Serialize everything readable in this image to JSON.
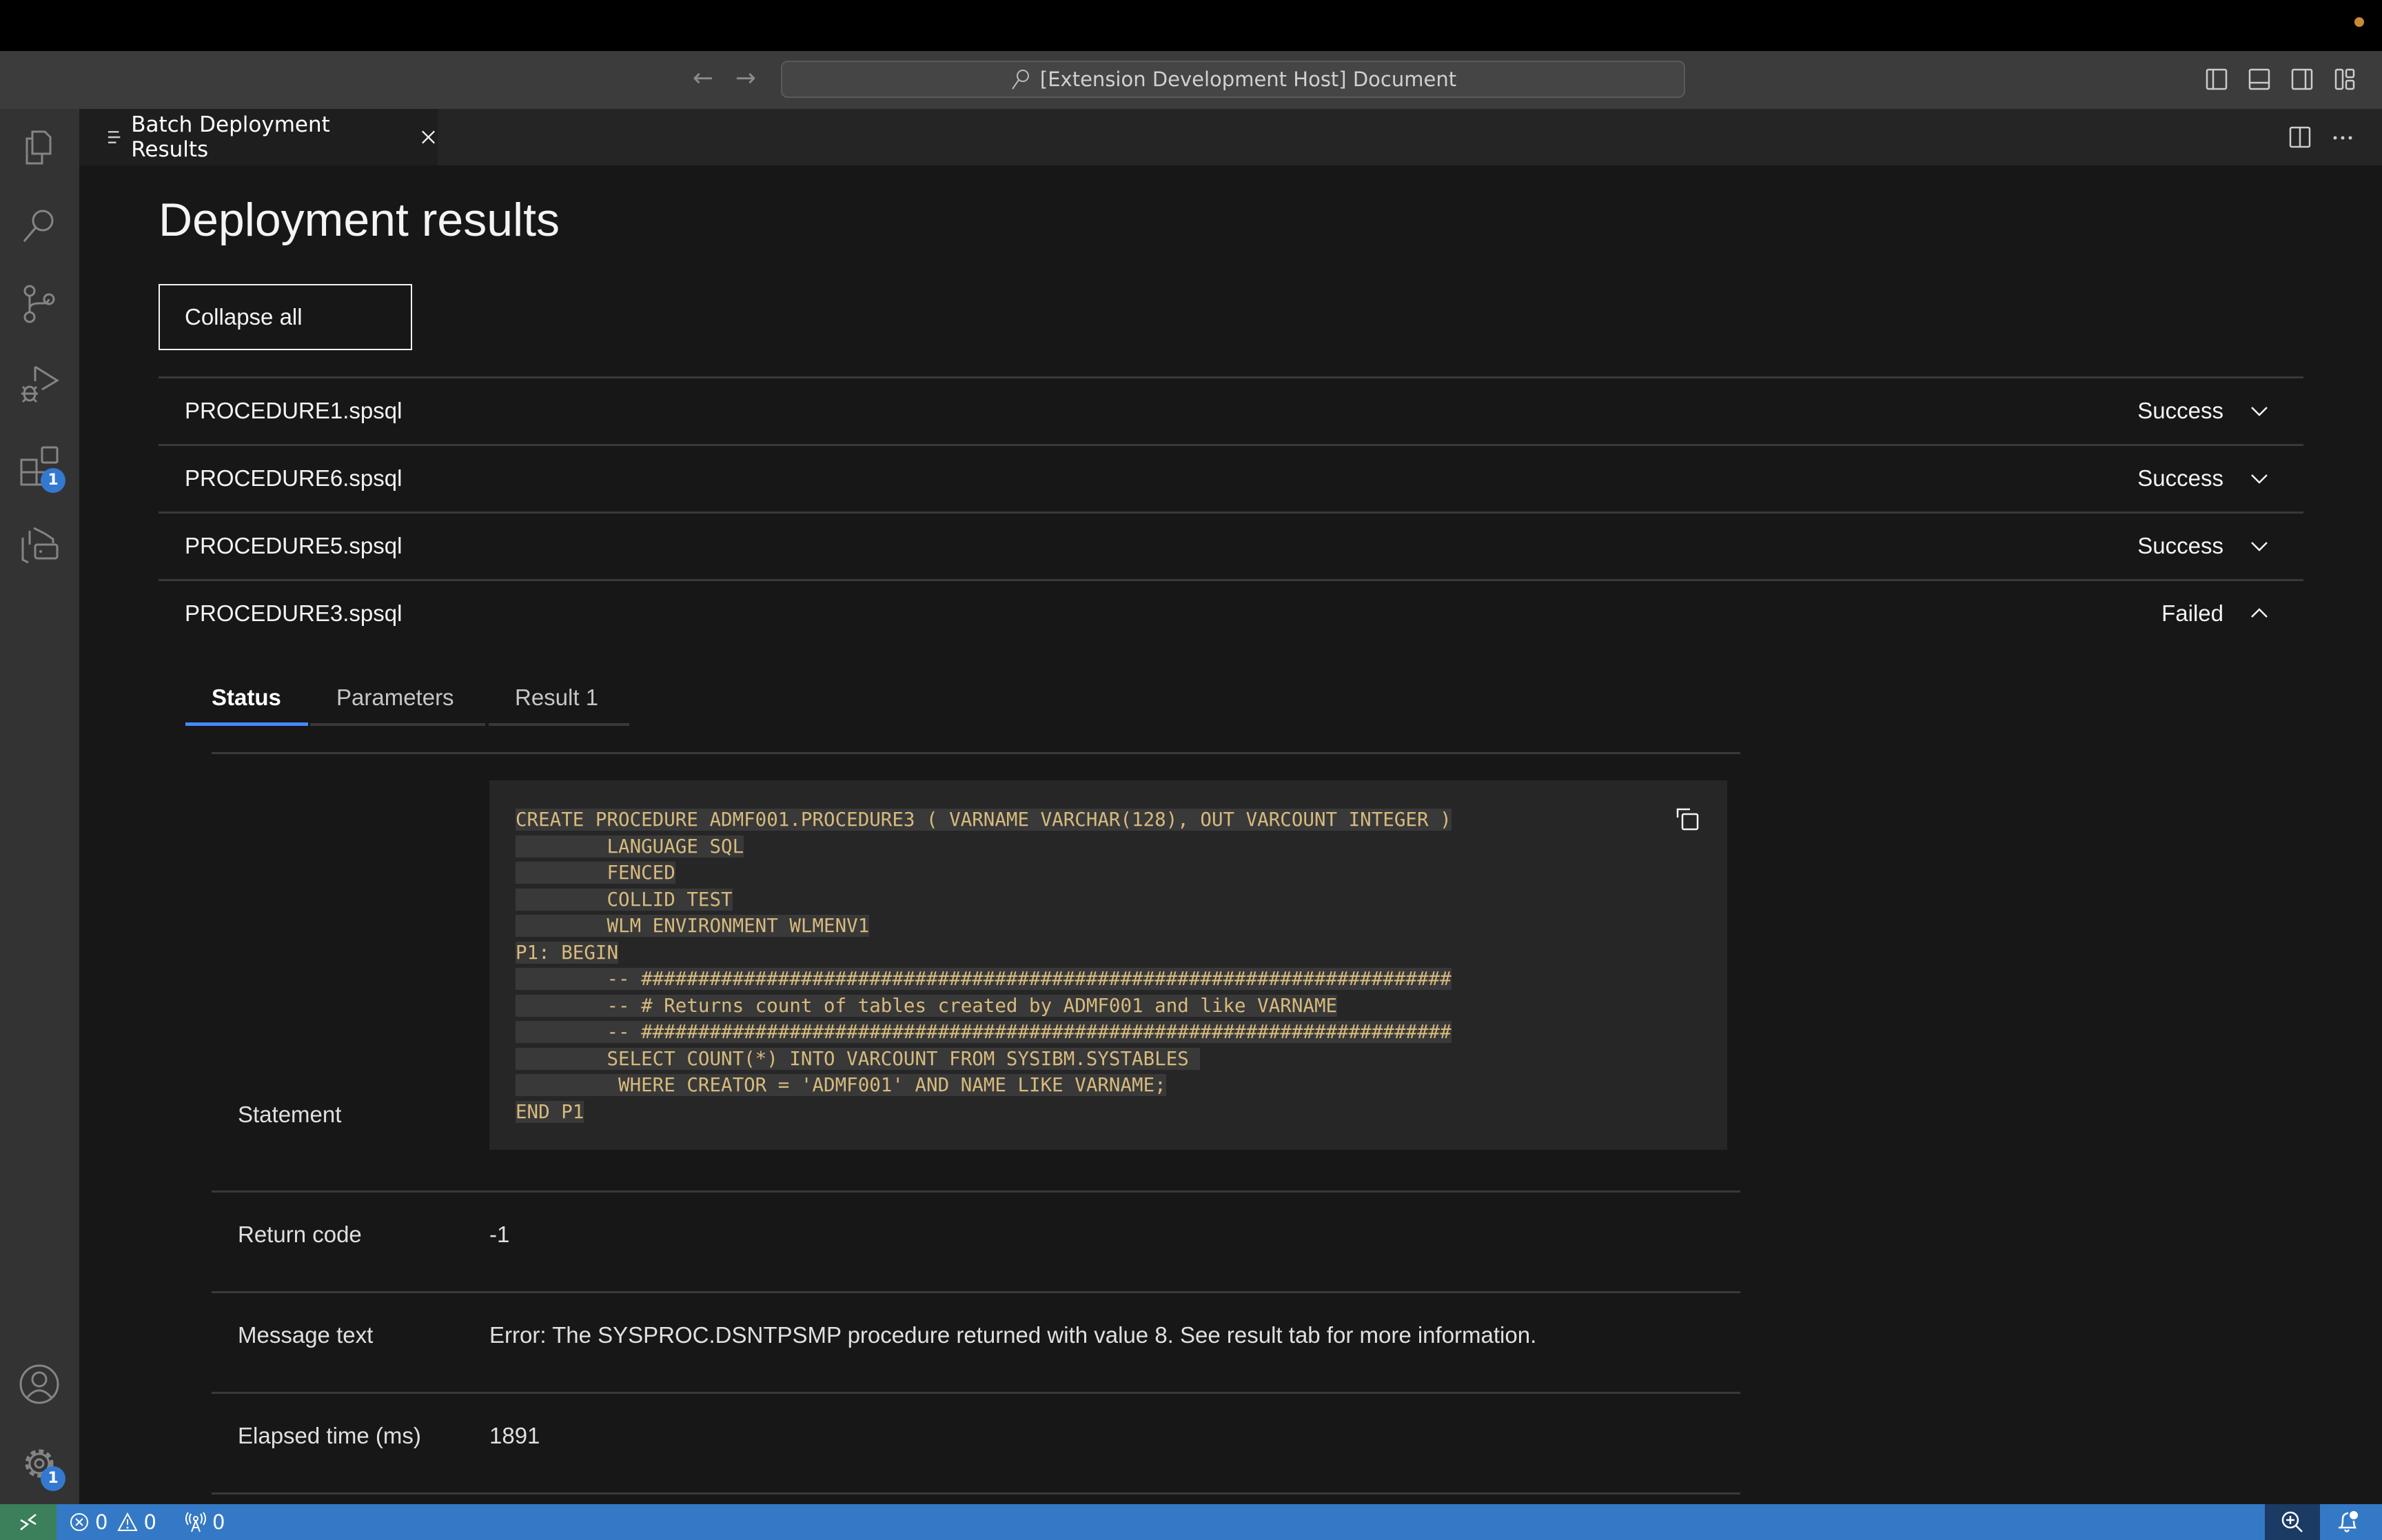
{
  "window": {
    "title": "[Extension Development Host] Document",
    "nav_back_icon": "arrow-left-icon",
    "nav_forward_icon": "arrow-right-icon",
    "layout_icons": [
      "toggle-primary-sidebar-icon",
      "toggle-panel-icon",
      "toggle-secondary-sidebar-icon",
      "customize-layout-icon"
    ]
  },
  "editor_tab": {
    "label": "Batch Deployment Results",
    "icon": "preview-icon",
    "close_icon": "close-icon",
    "actions": [
      "split-editor-icon",
      "more-actions-icon"
    ]
  },
  "activity_bar": {
    "items": [
      {
        "name": "explorer",
        "icon": "files-icon"
      },
      {
        "name": "search",
        "icon": "search-icon"
      },
      {
        "name": "source-control",
        "icon": "source-control-icon"
      },
      {
        "name": "run-and-debug",
        "icon": "run-debug-icon"
      },
      {
        "name": "extensions",
        "icon": "extensions-icon",
        "badge": "1"
      },
      {
        "name": "zowe-explorer",
        "icon": "zowe-explorer-icon"
      }
    ],
    "bottom": [
      {
        "name": "accounts",
        "icon": "account-icon"
      },
      {
        "name": "manage",
        "icon": "gear-icon",
        "badge": "1"
      }
    ]
  },
  "page": {
    "title": "Deployment results",
    "collapse_all_label": "Collapse all",
    "results": [
      {
        "file": "PROCEDURE1.spsql",
        "status": "Success",
        "expanded": false
      },
      {
        "file": "PROCEDURE6.spsql",
        "status": "Success",
        "expanded": false
      },
      {
        "file": "PROCEDURE5.spsql",
        "status": "Success",
        "expanded": false
      },
      {
        "file": "PROCEDURE3.spsql",
        "status": "Failed",
        "expanded": true
      }
    ],
    "detail_tabs": [
      {
        "label": "Status",
        "active": true
      },
      {
        "label": "Parameters",
        "active": false
      },
      {
        "label": "Result 1",
        "active": false
      }
    ],
    "status": {
      "statement_label": "Statement",
      "statement_lines": [
        "CREATE PROCEDURE ADMF001.PROCEDURE3 ( VARNAME VARCHAR(128), OUT VARCOUNT INTEGER )",
        "        LANGUAGE SQL",
        "        FENCED",
        "        COLLID TEST",
        "        WLM ENVIRONMENT WLMENV1",
        "P1: BEGIN",
        "        -- #######################################################################",
        "        -- # Returns count of tables created by ADMF001 and like VARNAME",
        "        -- #######################################################################",
        "        SELECT COUNT(*) INTO VARCOUNT FROM SYSIBM.SYSTABLES ",
        "         WHERE CREATOR = 'ADMF001' AND NAME LIKE VARNAME;",
        "END P1"
      ],
      "copy_icon": "copy-icon",
      "return_code_label": "Return code",
      "return_code": "-1",
      "message_text_label": "Message text",
      "message_text": "Error: The SYSPROC.DSNTPSMP procedure returned with value 8. See result tab for more information.",
      "elapsed_label": "Elapsed time (ms)",
      "elapsed": "1891"
    }
  },
  "status_bar": {
    "remote_icon": "remote-icon",
    "errors": "0",
    "warnings": "0",
    "ports": "0",
    "zoom_icon": "zoom-in-icon",
    "notifications_icon": "bell-dot-icon"
  },
  "colors": {
    "accent": "#4589ff",
    "status_bar": "#3479c6",
    "remote": "#3b7f5b",
    "code_text": "#d7ba7d",
    "badge": "#3479d0"
  }
}
